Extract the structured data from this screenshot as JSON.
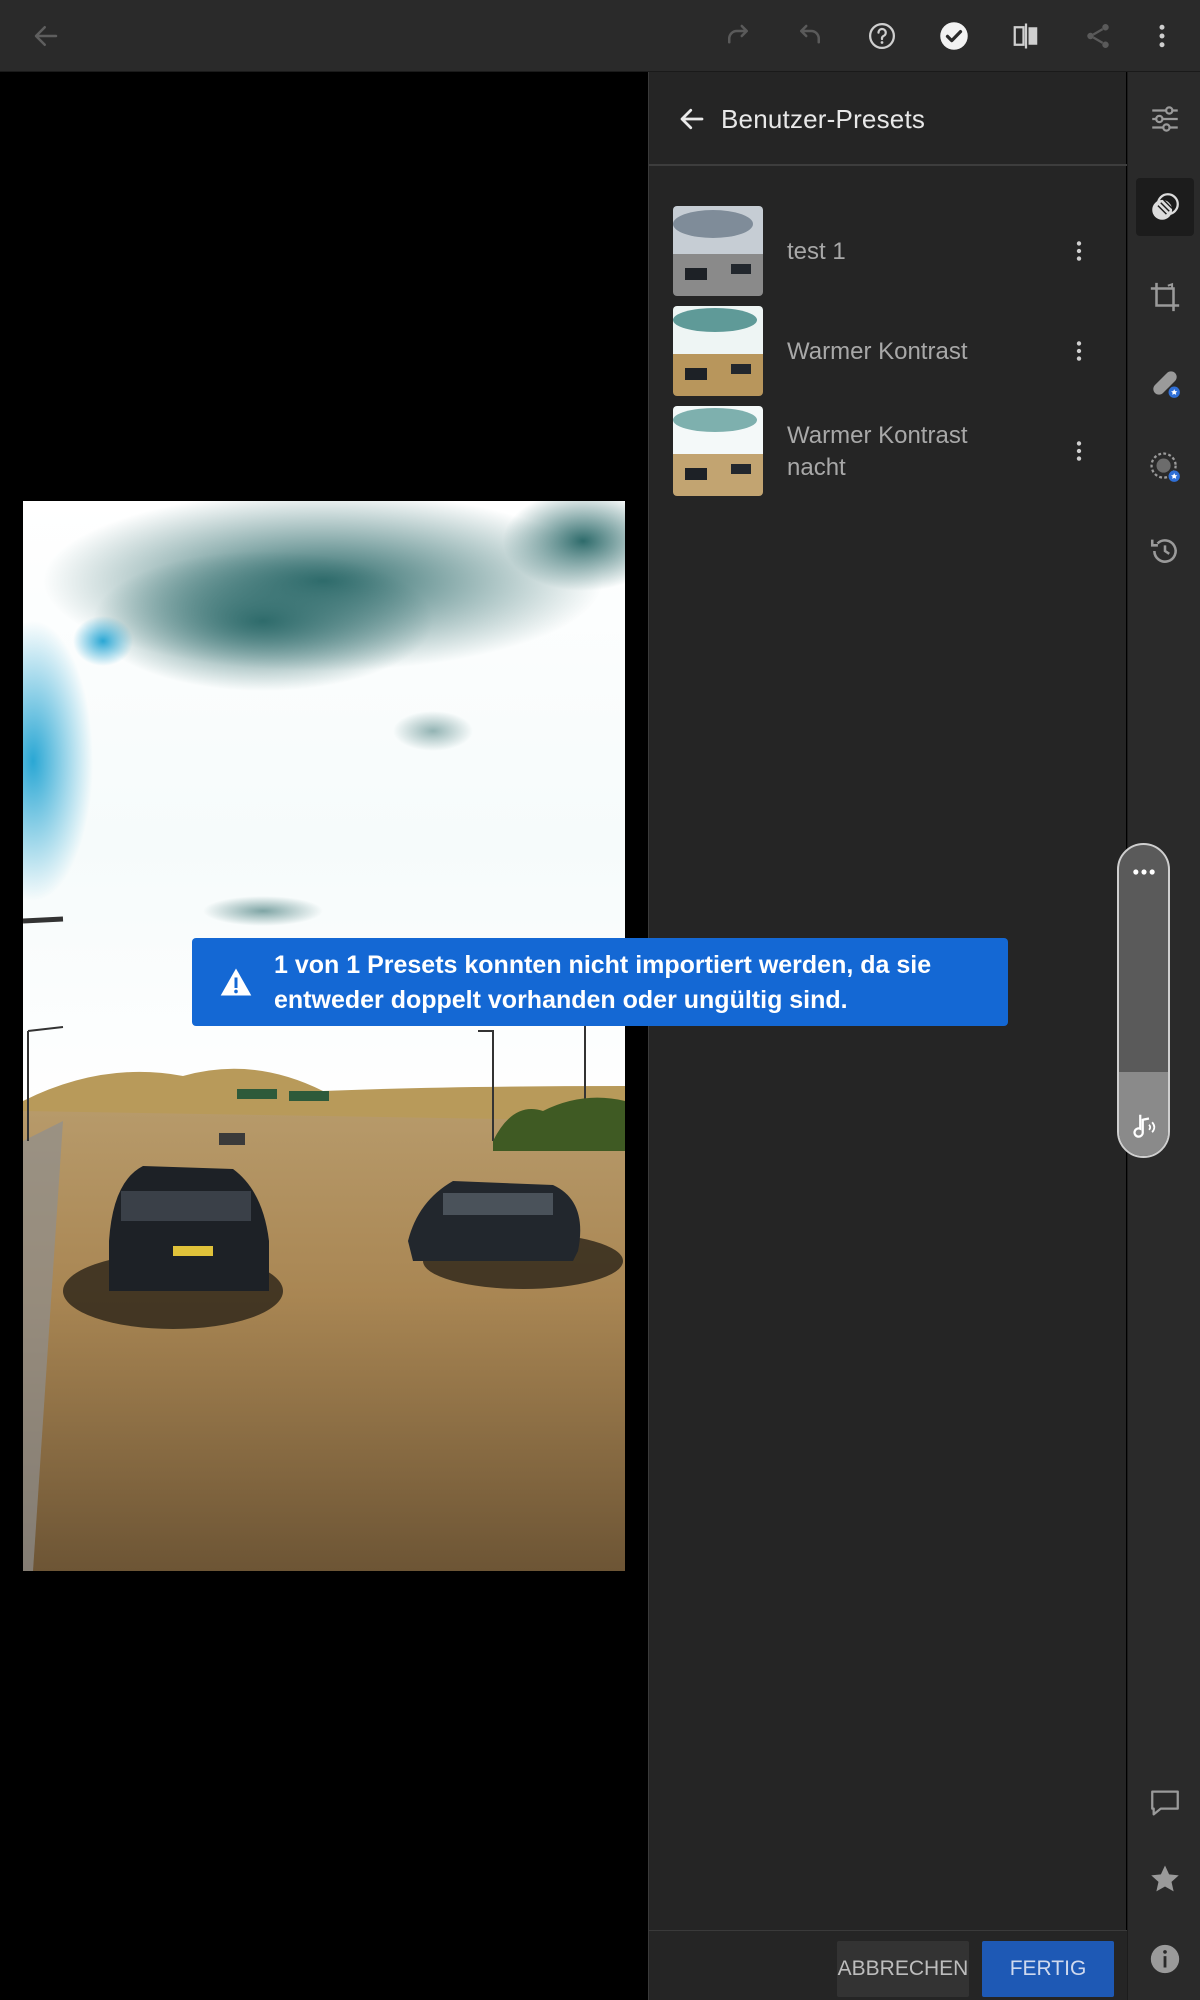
{
  "panel": {
    "title": "Benutzer-Presets",
    "presets": [
      {
        "name": "test 1"
      },
      {
        "name": "Warmer Kontrast"
      },
      {
        "name": "Warmer Kontrast nacht"
      }
    ],
    "cancel_label": "ABBRECHEN",
    "done_label": "FERTIG"
  },
  "toast": {
    "message": "1 von 1 Presets konnten nicht importiert werden, da sie entweder doppelt vorhanden oder ungültig sind."
  },
  "icons": {
    "toolbar": [
      "back-arrow-icon",
      "redo-icon",
      "undo-icon",
      "help-icon",
      "checkmark-icon",
      "compare-icon",
      "share-icon",
      "more-vertical-icon"
    ],
    "rail": [
      "sliders-icon",
      "presets-icon",
      "crop-icon",
      "healing-icon",
      "masking-icon",
      "history-icon",
      "comment-icon",
      "star-icon",
      "info-icon"
    ]
  },
  "colors": {
    "toolbar_bg": "#2a2a2a",
    "panel_bg": "#252525",
    "accent_blue": "#1e59b5",
    "toast_blue": "#1468d4",
    "badge_blue": "#2f6fd6"
  }
}
